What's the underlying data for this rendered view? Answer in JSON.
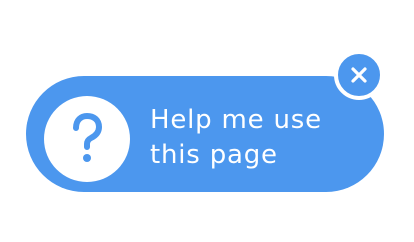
{
  "widget": {
    "line1": "Help me use",
    "line2": "this page",
    "help_icon": "question-mark-icon",
    "close_icon": "close-x-icon"
  },
  "colors": {
    "pill": "#4c97ee",
    "icon_background": "#ffffff",
    "text": "#ffffff"
  }
}
